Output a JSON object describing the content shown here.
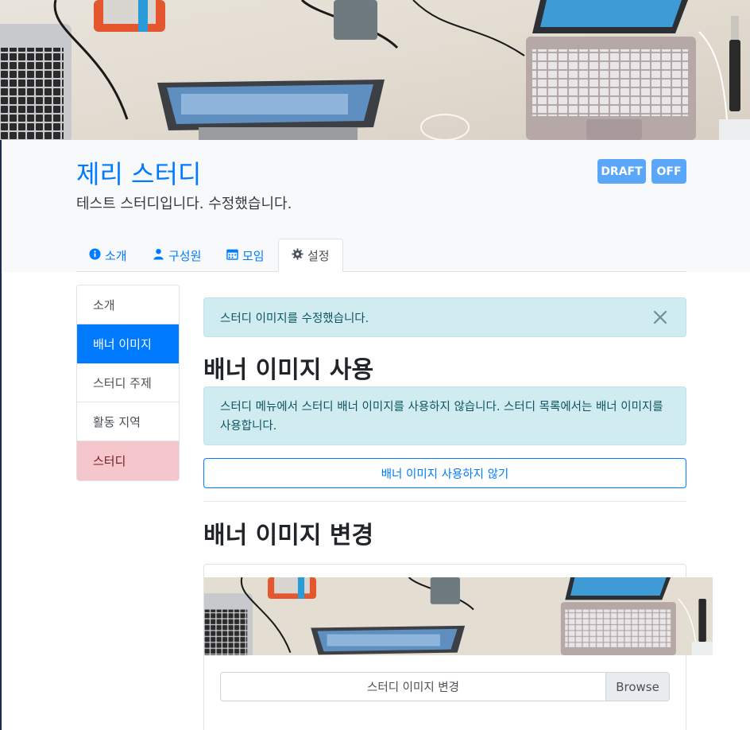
{
  "header": {
    "title": "제리 스터디",
    "description": "테스트 스터디입니다. 수정했습니다.",
    "badges": {
      "draft": "DRAFT",
      "off": "OFF"
    }
  },
  "tabs": [
    {
      "label": "소개",
      "icon": "info-circle-icon"
    },
    {
      "label": "구성원",
      "icon": "user-icon"
    },
    {
      "label": "모임",
      "icon": "calendar-icon"
    },
    {
      "label": "설정",
      "icon": "gear-icon",
      "active": true
    }
  ],
  "sidebar": {
    "items": [
      {
        "label": "소개"
      },
      {
        "label": "배너 이미지",
        "active": true
      },
      {
        "label": "스터디 주제"
      },
      {
        "label": "활동 지역"
      },
      {
        "label": "스터디",
        "variant": "danger"
      }
    ]
  },
  "main": {
    "alert_message": "스터디 이미지를 수정했습니다.",
    "section_use_title": "배너 이미지 사용",
    "info_text": "스터디 메뉴에서 스터디 배너 이미지를 사용하지 않습니다. 스터디 목록에서는 배너 이미지를 사용합니다.",
    "disable_button": "배너 이미지 사용하지 않기",
    "section_change_title": "배너 이미지 변경",
    "file_label": "스터디 이미지 변경",
    "browse_label": "Browse"
  },
  "colors": {
    "primary": "#007bff",
    "badge": "#5aa6f8",
    "info_bg": "#d1ecf1",
    "danger_bg": "#f5c6cb"
  }
}
